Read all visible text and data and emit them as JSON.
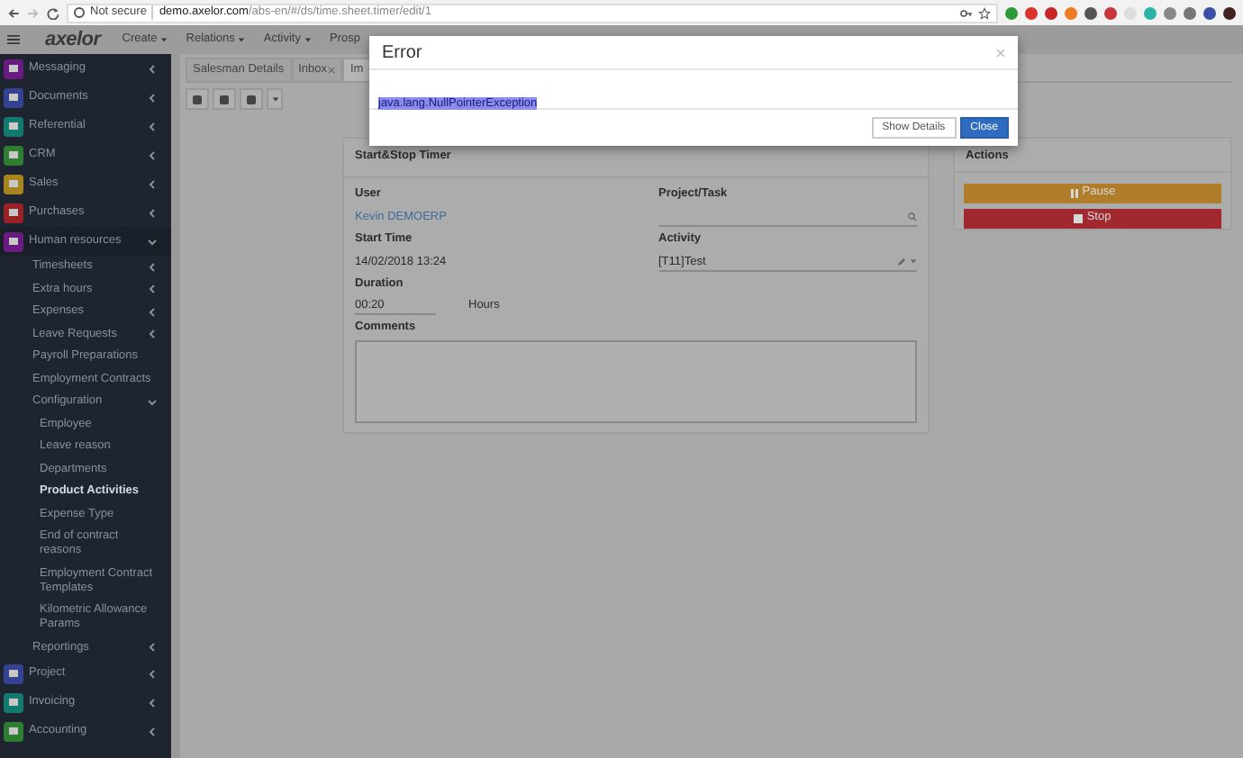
{
  "browser": {
    "security": "Not secure",
    "url_host": "demo.axelor.com",
    "url_path": "/abs-en/#/ds/time.sheet.timer/edit/1"
  },
  "navbar": {
    "logo": "axelor",
    "menus": [
      "Create",
      "Relations",
      "Activity",
      "Prosp"
    ]
  },
  "sidebar": {
    "items": [
      {
        "label": "Messaging",
        "color": "#6a1b80",
        "kind": "group",
        "expanded": false,
        "selected": false
      },
      {
        "label": "Documents",
        "color": "#34428f",
        "kind": "group",
        "expanded": false,
        "selected": false
      },
      {
        "label": "Referential",
        "color": "#13786e",
        "kind": "group",
        "expanded": false,
        "selected": false
      },
      {
        "label": "CRM",
        "color": "#2e7d32",
        "kind": "group",
        "expanded": false,
        "selected": false
      },
      {
        "label": "Sales",
        "color": "#a8841f",
        "kind": "group",
        "expanded": false,
        "selected": false
      },
      {
        "label": "Purchases",
        "color": "#9a2226",
        "kind": "group",
        "expanded": false,
        "selected": false
      },
      {
        "label": "Human resources",
        "color": "#6a1b80",
        "kind": "group",
        "expanded": true,
        "selected": false,
        "children": [
          {
            "label": "Timesheets",
            "kind": "group",
            "expanded": false,
            "selected": false
          },
          {
            "label": "Extra hours",
            "kind": "group",
            "expanded": false,
            "selected": false
          },
          {
            "label": "Expenses",
            "kind": "group",
            "expanded": false,
            "selected": false
          },
          {
            "label": "Leave Requests",
            "kind": "group",
            "expanded": false,
            "selected": false
          },
          {
            "label": "Payroll Preparations",
            "kind": "leaf",
            "selected": false
          },
          {
            "label": "Employment Contracts",
            "kind": "leaf",
            "selected": false
          },
          {
            "label": "Configuration",
            "kind": "group",
            "expanded": true,
            "selected": false,
            "children": [
              {
                "label": "Employee",
                "kind": "leaf",
                "selected": false
              },
              {
                "label": "Leave reason",
                "kind": "leaf",
                "selected": false
              },
              {
                "label": "Departments",
                "kind": "leaf",
                "selected": false
              },
              {
                "label": "Product Activities",
                "kind": "leaf",
                "selected": true
              },
              {
                "label": "Expense Type",
                "kind": "leaf",
                "selected": false
              },
              {
                "label": "End of contract reasons",
                "kind": "leaf",
                "selected": false
              },
              {
                "label": "Employment Contract Templates",
                "kind": "leaf",
                "selected": false
              },
              {
                "label": "Kilometric Allowance Params",
                "kind": "leaf",
                "selected": false
              }
            ]
          },
          {
            "label": "Reportings",
            "kind": "group",
            "expanded": false,
            "selected": false
          }
        ]
      },
      {
        "label": "Project",
        "color": "#34428f",
        "kind": "group",
        "expanded": false,
        "selected": false
      },
      {
        "label": "Invoicing",
        "color": "#13786e",
        "kind": "group",
        "expanded": false,
        "selected": false
      },
      {
        "label": "Accounting",
        "color": "#2e7d32",
        "kind": "group",
        "expanded": false,
        "selected": false
      }
    ]
  },
  "tabs": [
    {
      "label": "Salesman Details",
      "closable": false,
      "selected": false
    },
    {
      "label": "Inbox",
      "closable": true,
      "selected": false
    },
    {
      "label": "Im",
      "closable": false,
      "selected": true
    }
  ],
  "form": {
    "title": "Start&Stop Timer",
    "user_label": "User",
    "user": "Kevin DEMOERP",
    "project_label": "Project/Task",
    "start_label": "Start Time",
    "start": "14/02/2018 13:24",
    "activity_label": "Activity",
    "activity": "[T11]Test",
    "duration_label": "Duration",
    "duration": "00:20",
    "duration_unit": "Hours",
    "comments_label": "Comments"
  },
  "actions": {
    "title": "Actions",
    "buttons": [
      {
        "label": "Pause",
        "kind": "pause"
      },
      {
        "label": "Stop",
        "kind": "stop"
      }
    ]
  },
  "dialog": {
    "title": "Error",
    "message": "java.lang.NullPointerException",
    "message_selected": true,
    "buttons": [
      {
        "label": "Show Details",
        "kind": "default"
      },
      {
        "label": "Close",
        "kind": "primary"
      }
    ]
  }
}
